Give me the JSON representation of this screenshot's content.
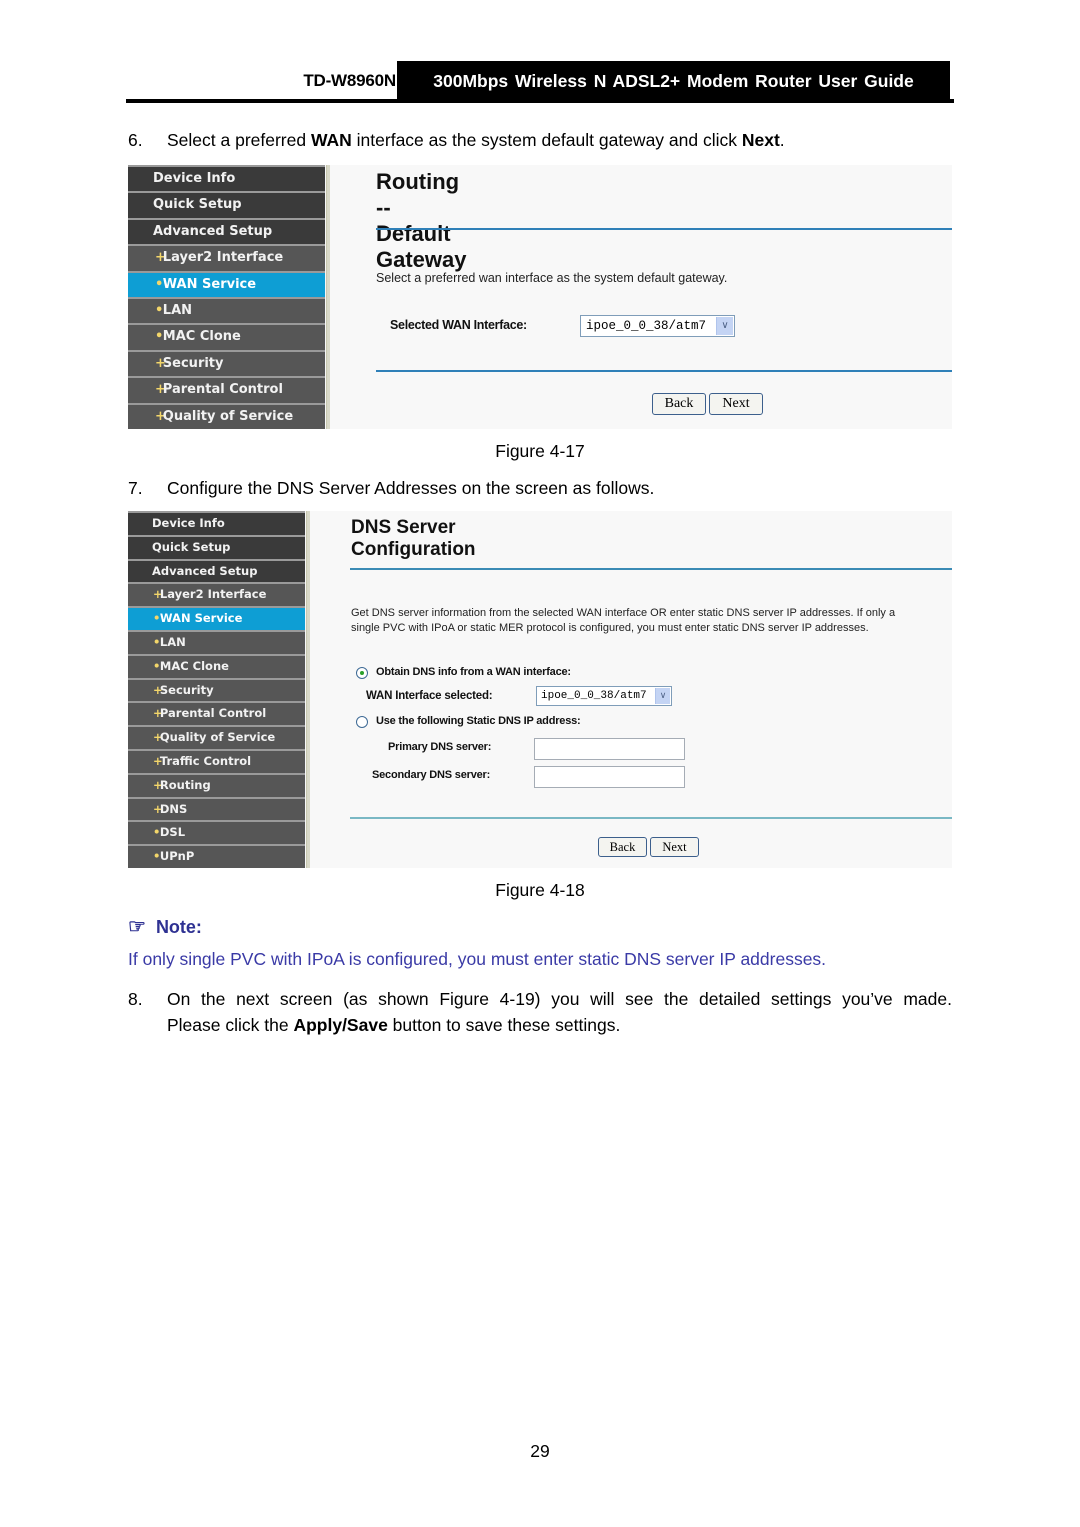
{
  "header": {
    "model": "TD-W8960N",
    "title": "300Mbps  Wireless  N  ADSL2+  Modem  Router  User  Guide"
  },
  "steps": [
    {
      "number": "6.",
      "text_before": "Select a preferred ",
      "bold1": "WAN",
      "text_middle": " interface as the system default gateway and click ",
      "bold2": "Next",
      "text_after": "."
    },
    {
      "number": "7.",
      "text": "Configure the DNS Server Addresses on the screen as follows."
    },
    {
      "number": "8.",
      "line1": "On the next screen (as shown Figure 4-19) you will see the detailed settings you’ve made.",
      "line2_before": "Please click the ",
      "line2_bold": "Apply/Save",
      "line2_after": " button to save these settings."
    }
  ],
  "figure1": {
    "caption": "Figure 4-17",
    "nav": [
      {
        "label": "Device Info",
        "bullet": "",
        "level": "top"
      },
      {
        "label": "Quick Setup",
        "bullet": "",
        "level": "top"
      },
      {
        "label": "Advanced Setup",
        "bullet": "",
        "level": "top"
      },
      {
        "label": "Layer2 Interface",
        "bullet": "+",
        "level": "sub"
      },
      {
        "label": "WAN Service",
        "bullet": "•",
        "level": "active"
      },
      {
        "label": "LAN",
        "bullet": "•",
        "level": "sub"
      },
      {
        "label": "MAC Clone",
        "bullet": "•",
        "level": "sub"
      },
      {
        "label": "Security",
        "bullet": "+",
        "level": "sub"
      },
      {
        "label": "Parental Control",
        "bullet": "+",
        "level": "sub"
      },
      {
        "label": "Quality of Service",
        "bullet": "+",
        "level": "sub"
      }
    ],
    "title": "Routing -- Default Gateway",
    "description": "Select a preferred wan interface as the system default gateway.",
    "field_label": "Selected WAN Interface:",
    "field_value": "ipoe_0_0_38/atm7",
    "back_label": "Back",
    "next_label": "Next"
  },
  "figure2": {
    "caption": "Figure 4-18",
    "nav": [
      {
        "label": "Device Info",
        "bullet": "",
        "level": "top"
      },
      {
        "label": "Quick Setup",
        "bullet": "",
        "level": "top"
      },
      {
        "label": "Advanced Setup",
        "bullet": "",
        "level": "top"
      },
      {
        "label": "Layer2 Interface",
        "bullet": "+",
        "level": "sub"
      },
      {
        "label": "WAN Service",
        "bullet": "•",
        "level": "active"
      },
      {
        "label": "LAN",
        "bullet": "•",
        "level": "sub"
      },
      {
        "label": "MAC Clone",
        "bullet": "•",
        "level": "sub"
      },
      {
        "label": "Security",
        "bullet": "+",
        "level": "sub"
      },
      {
        "label": "Parental Control",
        "bullet": "+",
        "level": "sub"
      },
      {
        "label": "Quality of Service",
        "bullet": "+",
        "level": "sub"
      },
      {
        "label": "Traffic Control",
        "bullet": "+",
        "level": "sub"
      },
      {
        "label": "Routing",
        "bullet": "+",
        "level": "sub"
      },
      {
        "label": "DNS",
        "bullet": "+",
        "level": "sub"
      },
      {
        "label": "DSL",
        "bullet": "•",
        "level": "sub"
      },
      {
        "label": "UPnP",
        "bullet": "•",
        "level": "sub"
      }
    ],
    "title": "DNS Server Configuration",
    "description_line1": "Get DNS server information from the selected WAN interface OR enter static DNS server IP addresses. If only a",
    "description_line2": "single PVC with IPoA or static MER protocol is configured, you must enter static DNS server IP addresses.",
    "option1_label": "Obtain DNS info from a WAN interface:",
    "option1_selected": true,
    "wan_label": "WAN Interface selected:",
    "wan_value": "ipoe_0_0_38/atm7",
    "option2_label": "Use the following Static DNS IP address:",
    "option2_selected": false,
    "primary_label": "Primary DNS server:",
    "primary_value": "",
    "secondary_label": "Secondary DNS server:",
    "secondary_value": "",
    "back_label": "Back",
    "next_label": "Next"
  },
  "note": {
    "icon": "pointing-hand-icon",
    "heading": "Note:",
    "text": "If only single PVC with IPoA is configured, you must enter static DNS server IP addresses."
  },
  "page_number": "29",
  "colors": {
    "note_blue": "#2e3192",
    "active_nav": "#0e9ed4",
    "nav_dark": "#474747",
    "rule_blue": "#2f80b8"
  }
}
